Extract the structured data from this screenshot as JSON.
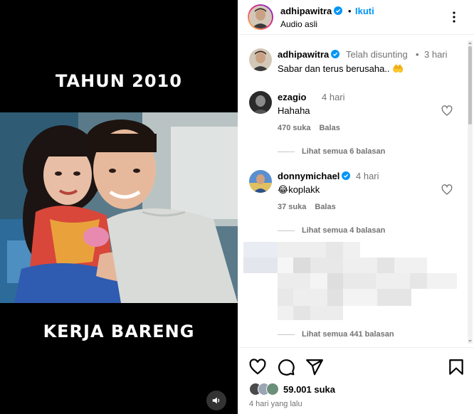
{
  "media": {
    "caption_top": "TAHUN 2010",
    "caption_bottom": "KERJA BARENG"
  },
  "header": {
    "username": "adhipawitra",
    "separator": "•",
    "follow_label": "Ikuti",
    "subtitle": "Audio asli"
  },
  "comments": [
    {
      "username": "adhipawitra",
      "meta": "Telah disunting",
      "separator": "•",
      "time": "3 hari",
      "text": "Sabar dan terus berusaha.. 🤲",
      "verified": true
    },
    {
      "username": "ezagio",
      "time": "4 hari",
      "text": "Hahaha",
      "likes": "470 suka",
      "reply_label": "Balas",
      "view_replies": "Lihat semua 6 balasan"
    },
    {
      "username": "donnymichael",
      "time": "4 hari",
      "text": "😂koplakk",
      "likes": "37 suka",
      "reply_label": "Balas",
      "view_replies": "Lihat semua 4 balasan",
      "verified": true
    },
    {
      "view_replies": "Lihat semua 441 balasan"
    }
  ],
  "footer": {
    "likes": "59.001 suka",
    "time_ago": "4 hari yang lalu"
  },
  "colors": {
    "accent": "#0095f6",
    "muted": "#737373",
    "media_bg": "#000000"
  },
  "icons": [
    "verified-badge-icon",
    "more-options-icon",
    "heart-icon",
    "comment-icon",
    "share-icon",
    "bookmark-icon",
    "audio-icon"
  ]
}
